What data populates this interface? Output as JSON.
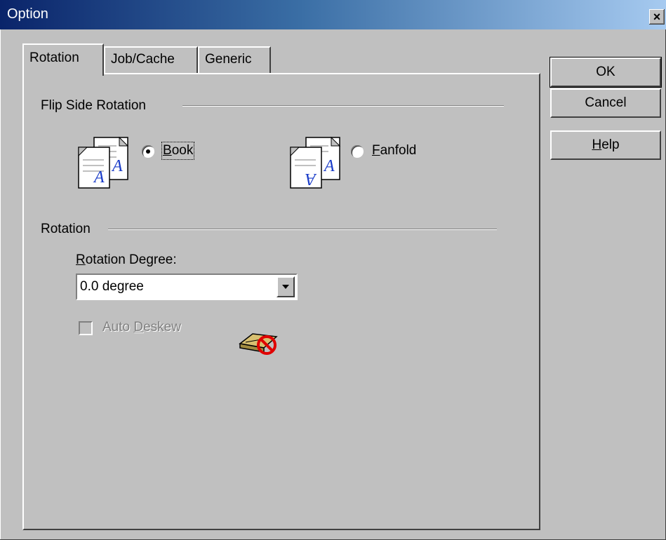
{
  "window": {
    "title": "Option",
    "close_glyph": "×"
  },
  "tabs": [
    {
      "label": "Rotation",
      "active": true
    },
    {
      "label": "Job/Cache",
      "active": false
    },
    {
      "label": "Generic",
      "active": false
    }
  ],
  "buttons": {
    "ok": "OK",
    "cancel": "Cancel",
    "help_mnemonic": "H",
    "help_rest": "elp"
  },
  "flip_side": {
    "group_label": "Flip Side Rotation",
    "book": {
      "mnemonic": "B",
      "rest": "ook",
      "selected": true,
      "icon": "book-pages-icon"
    },
    "fanfold": {
      "mnemonic": "F",
      "rest": "anfold",
      "selected": false,
      "icon": "fanfold-pages-icon"
    }
  },
  "rotation": {
    "group_label": "Rotation",
    "degree_label_mnemonic": "R",
    "degree_label_rest": "otation Degree:",
    "degree_value": "0.0 degree",
    "auto_deskew_pre": "Auto ",
    "auto_deskew_mnemonic": "D",
    "auto_deskew_rest": "eskew",
    "auto_deskew_checked": false,
    "auto_deskew_enabled": false,
    "deskew_icon": "deskew-unavailable-icon"
  },
  "colors": {
    "title_start": "#0a246a",
    "title_end": "#a6caf0",
    "face": "#c0c0c0",
    "icon_blue": "#1a3cc8",
    "prohibit_red": "#e00000"
  }
}
